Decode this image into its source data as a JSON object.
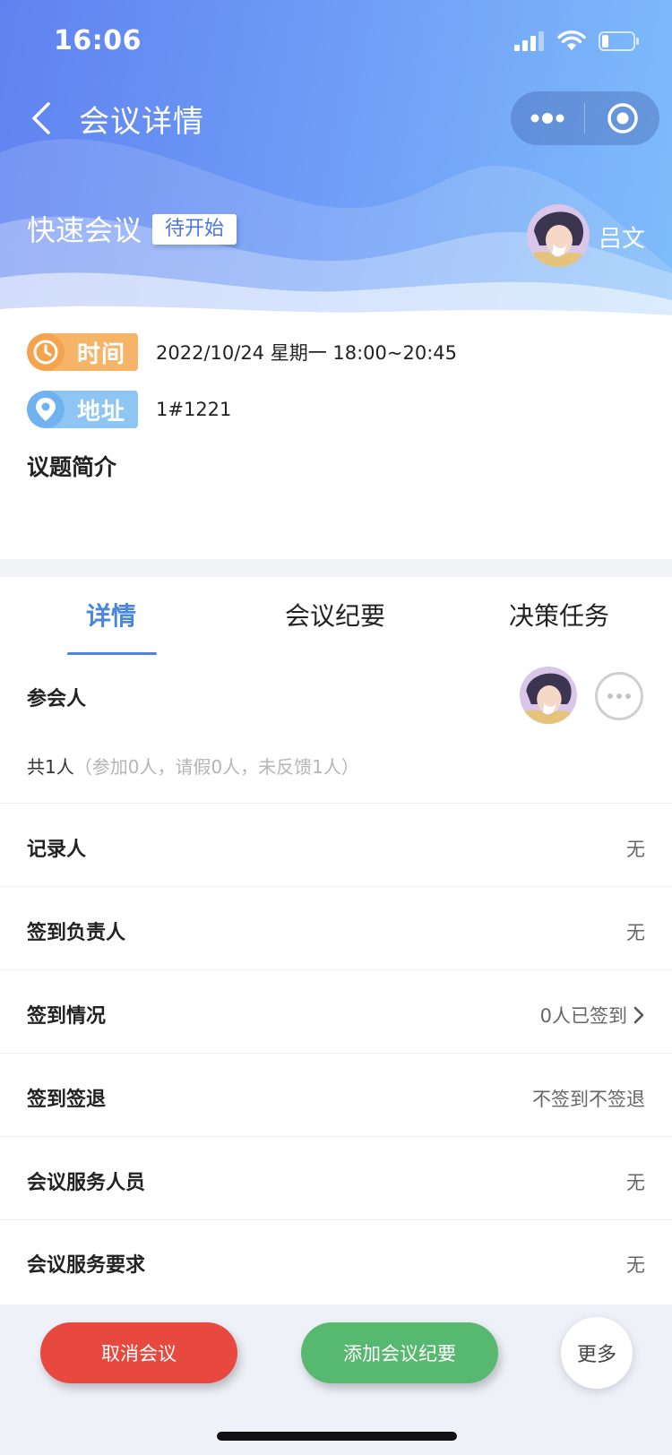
{
  "status_bar": {
    "time": "16:06"
  },
  "nav": {
    "title": "会议详情"
  },
  "meeting": {
    "title": "快速会议",
    "status": "待开始",
    "host_name": "吕文"
  },
  "info": {
    "time_label": "时间",
    "time_value": "2022/10/24 星期一 18:00~20:45",
    "address_label": "地址",
    "address_value": "1#1221",
    "topic_title": "议题简介"
  },
  "tabs": [
    {
      "label": "详情",
      "active": true
    },
    {
      "label": "会议纪要",
      "active": false
    },
    {
      "label": "决策任务",
      "active": false
    }
  ],
  "attendees": {
    "label": "参会人",
    "count_main": "共1人",
    "count_detail": "（参加0人，请假0人，未反馈1人）"
  },
  "rows": [
    {
      "label": "记录人",
      "value": "无"
    },
    {
      "label": "签到负责人",
      "value": "无"
    },
    {
      "label": "签到情况",
      "value": "0人已签到"
    },
    {
      "label": "签到签退",
      "value": "不签到不签退"
    },
    {
      "label": "会议服务人员",
      "value": "无"
    },
    {
      "label": "会议服务要求",
      "value": "无"
    }
  ],
  "actions": {
    "cancel": "取消会议",
    "add_minutes": "添加会议纪要",
    "more": "更多"
  },
  "colors": {
    "accent": "#4a86df",
    "cancel": "#e8493f",
    "add": "#57b96f",
    "time_pill": "#f6b469",
    "address_pill": "#8fc5f3"
  }
}
